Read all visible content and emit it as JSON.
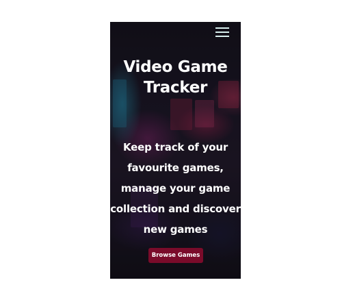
{
  "hero": {
    "title": "Video Game Tracker",
    "tagline": "Keep track of your favourite games, manage your game collection and discover new games"
  },
  "actions": {
    "browse_label": "Browse Games"
  },
  "icons": {
    "menu": "hamburger-menu-icon"
  },
  "colors": {
    "button_bg": "#7a0b2a",
    "text": "#ffffff",
    "menu_icon": "#d8f0ee"
  }
}
